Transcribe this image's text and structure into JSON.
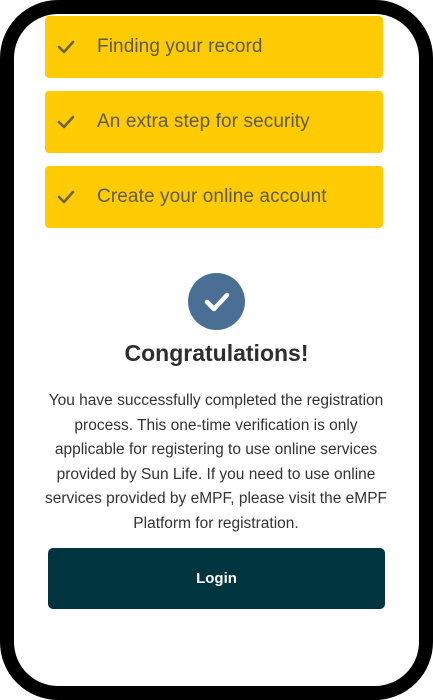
{
  "steps": [
    {
      "label": "Finding your record",
      "icon": "check-icon",
      "status": "complete"
    },
    {
      "label": "An extra step for security",
      "icon": "check-icon",
      "status": "complete"
    },
    {
      "label": "Create your online account",
      "icon": "check-icon",
      "status": "complete"
    }
  ],
  "success": {
    "icon": "checkmark-circle-icon",
    "title": "Congratulations!",
    "message": "You have successfully completed the registration process. This one-time verification is only applicable for registering to use online services provided by Sun Life. If you need to use online services provided by eMPF, please visit the eMPF Platform for registration."
  },
  "actions": {
    "login_label": "Login"
  },
  "colors": {
    "step_background": "#ffcb05",
    "step_text": "#5e5a4a",
    "check": "#6b6440",
    "badge": "#4b6f94",
    "button": "#00343f",
    "bezel": "#000000"
  }
}
